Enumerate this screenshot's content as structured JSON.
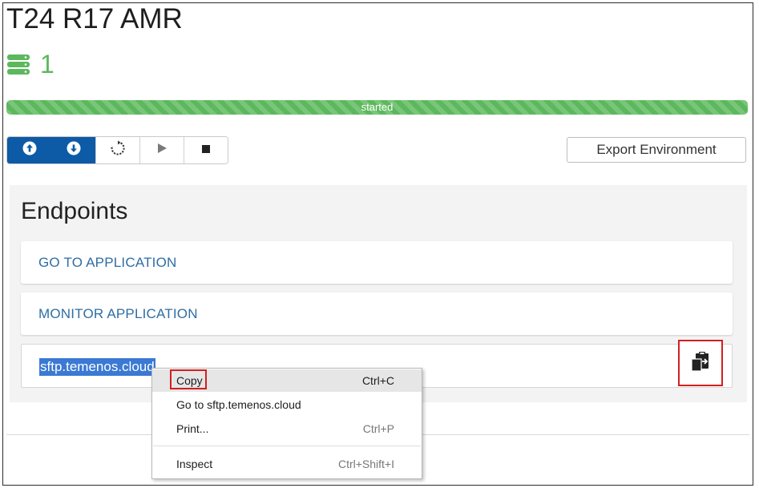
{
  "environment": {
    "title": "T24 R17 AMR",
    "server_icon": "server-stack-icon",
    "server_count": "1",
    "status": "started",
    "status_color": "#5cb85c"
  },
  "toolbar": {
    "buttons": [
      {
        "icon": "upload-circle-icon"
      },
      {
        "icon": "download-circle-icon"
      },
      {
        "icon": "restart-icon"
      },
      {
        "icon": "play-icon"
      },
      {
        "icon": "stop-icon"
      }
    ],
    "primary_color": "#0d5aa7",
    "export_label": "Export Environment"
  },
  "endpoints": {
    "title": "Endpoints",
    "links": [
      "GO TO APPLICATION",
      "MONITOR APPLICATION"
    ],
    "sftp_value": "sftp.temenos.cloud",
    "copy_icon": "clipboard-copy-icon"
  },
  "context_menu": {
    "items": [
      {
        "label": "Copy",
        "shortcut": "Ctrl+C"
      },
      {
        "label": "Go to sftp.temenos.cloud",
        "shortcut": ""
      },
      {
        "label": "Print...",
        "shortcut": "Ctrl+P"
      },
      {
        "label": "Inspect",
        "shortcut": "Ctrl+Shift+I"
      }
    ]
  }
}
